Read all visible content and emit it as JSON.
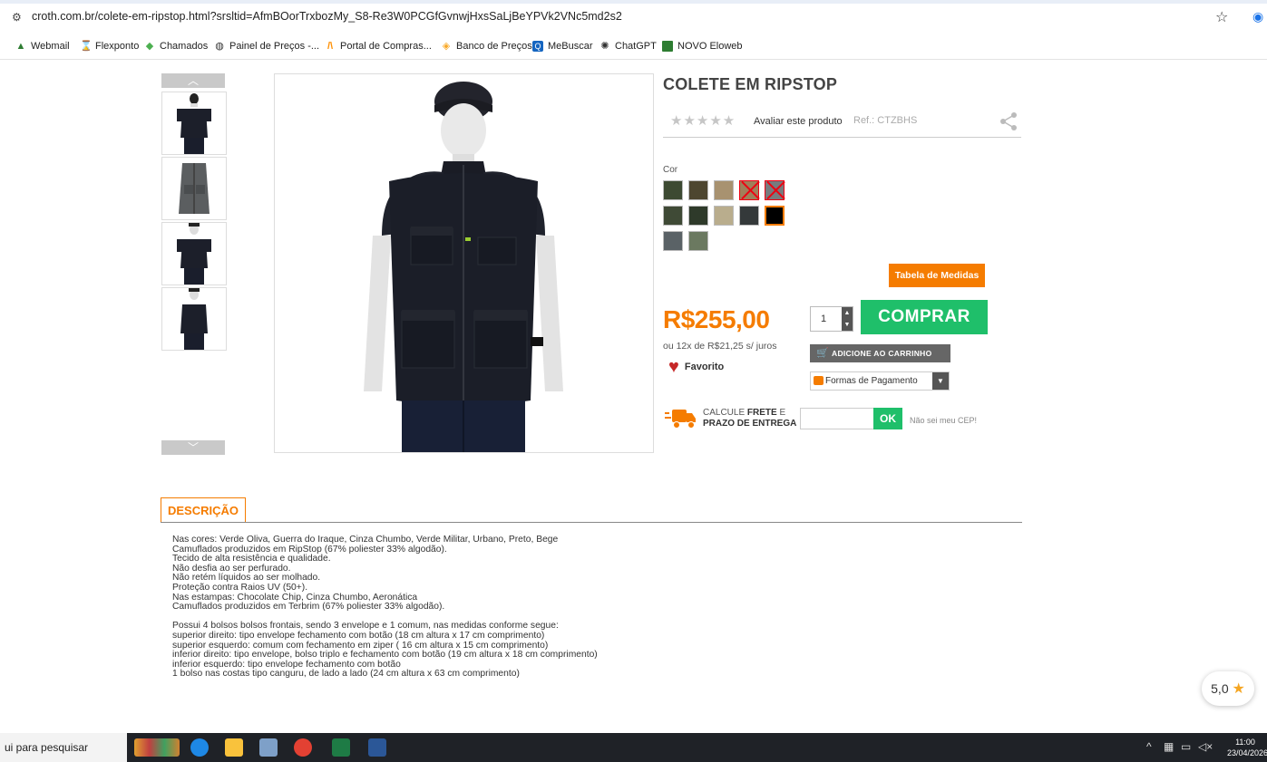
{
  "browser": {
    "url": "croth.com.br/colete-em-ripstop.html?srsltid=AfmBOorTrxbozMy_S8-Re3W0PCGfGvnwjHxsSaLjBeYPVk2VNc5md2s2",
    "bookmarks": [
      "Webmail",
      "Flexponto",
      "Chamados",
      "Painel de Preços -...",
      "Portal de Compras...",
      "Banco de Preços",
      "MeBuscar",
      "ChatGPT",
      "NOVO Eloweb"
    ]
  },
  "product": {
    "title": "COLETE EM RIPSTOP",
    "stars": "★★★★★",
    "rate_label": "Avaliar este produto",
    "ref": "Ref.: CTZBHS",
    "color_label": "Cor",
    "sizes_button": "Tabela de Medidas",
    "price": "R$255,00",
    "installments": "ou 12x de R$21,25 s/ juros",
    "favorite": "Favorito",
    "quantity": "1",
    "buy_button": "COMPRAR",
    "add_to_cart": "ADICIONE AO CARRINHO",
    "payment": "Formas de Pagamento",
    "shipping_line1_pre": "CALCULE ",
    "shipping_line1_bold": "FRETE",
    "shipping_line1_post": " E",
    "shipping_line2": "PRAZO DE ENTREGA",
    "ok_button": "OK",
    "no_cep": "Não sei meu CEP!"
  },
  "swatch_colors": [
    "#3d4a32",
    "#4d4630",
    "#a89270",
    "#a0805a",
    "#787b7e",
    "#3f4a36",
    "#2e3a2a",
    "#b9ad8d",
    "#34393a",
    "#000000",
    "#5a6266",
    "#6b7960"
  ],
  "description": {
    "tab": "DESCRIÇÃO",
    "lines": [
      "Nas cores: Verde Oliva, Guerra do Iraque, Cinza Chumbo, Verde Militar, Urbano, Preto, Bege",
      "Camuflados produzidos em RipStop (67% poliester 33% algodão).",
      "Tecido de alta resistência e qualidade.",
      "Não desfia ao ser perfurado.",
      "Não retém líquidos ao ser molhado.",
      "Proteção contra Raios UV (50+).",
      "Nas estampas: Chocolate Chip, Cinza Chumbo, Aeronática",
      "Camuflados produzidos em Terbrim (67% poliester 33% algodão).",
      "",
      "Possui 4 bolsos bolsos frontais, sendo 3 envelope e 1 comum, nas medidas conforme segue:",
      "superior direito: tipo envelope fechamento com botão (18 cm altura x 17 cm comprimento)",
      "superior esquerdo: comum com fechamento em ziper ( 16 cm altura x 15 cm comprimento)",
      "inferior direito: tipo envelope, bolso triplo e fechamento com botão (19 cm altura x 18 cm comprimento)",
      "inferior esquerdo: tipo envelope fechamento com botão",
      "1 bolso nas costas tipo canguru, de lado a lado (24 cm altura x 63 cm comprimento)"
    ]
  },
  "score": {
    "value": "5,0",
    "star": "★"
  },
  "taskbar": {
    "search": "ui para pesquisar",
    "time": "11:00",
    "date": "23/04/2026"
  }
}
